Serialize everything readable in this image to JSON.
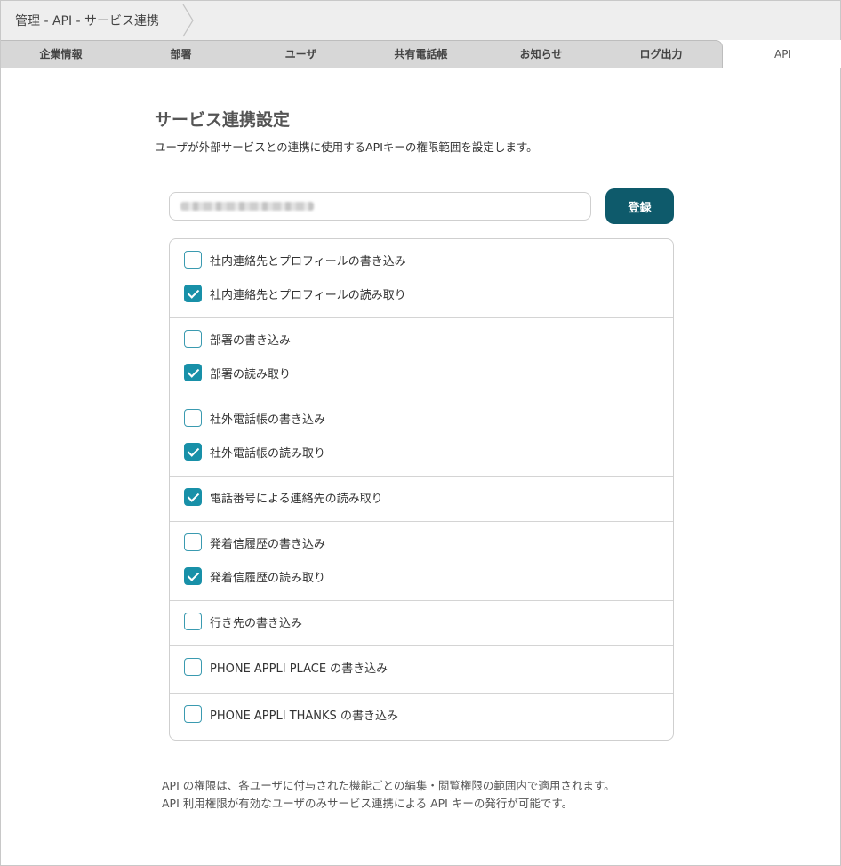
{
  "breadcrumb": "管理 - API - サービス連携",
  "tabs": [
    {
      "label": "企業情報",
      "active": false
    },
    {
      "label": "部署",
      "active": false
    },
    {
      "label": "ユーザ",
      "active": false
    },
    {
      "label": "共有電話帳",
      "active": false
    },
    {
      "label": "お知らせ",
      "active": false
    },
    {
      "label": "ログ出力",
      "active": false
    },
    {
      "label": "API",
      "active": true
    }
  ],
  "main": {
    "title": "サービス連携設定",
    "description": "ユーザが外部サービスとの連携に使用するAPIキーの権限範囲を設定します。",
    "register_label": "登録"
  },
  "permissions": [
    {
      "label": "社内連絡先とプロフィールの書き込み",
      "checked": false
    },
    {
      "label": "社内連絡先とプロフィールの読み取り",
      "checked": true
    },
    {
      "label": "部署の書き込み",
      "checked": false
    },
    {
      "label": "部署の読み取り",
      "checked": true
    },
    {
      "label": "社外電話帳の書き込み",
      "checked": false
    },
    {
      "label": "社外電話帳の読み取り",
      "checked": true
    },
    {
      "label": "電話番号による連絡先の読み取り",
      "checked": true
    },
    {
      "label": "発着信履歴の書き込み",
      "checked": false
    },
    {
      "label": "発着信履歴の読み取り",
      "checked": true
    },
    {
      "label": "行き先の書き込み",
      "checked": false
    },
    {
      "label": "PHONE APPLI PLACE の書き込み",
      "checked": false
    },
    {
      "label": "PHONE APPLI THANKS の書き込み",
      "checked": false
    }
  ],
  "notes": [
    "API の権限は、各ユーザに付与された機能ごとの編集・閲覧権限の範囲内で適用されます。",
    "API 利用権限が有効なユーザのみサービス連携による API キーの発行が可能です。"
  ],
  "colors": {
    "accent": "#1890a8",
    "button": "#0e5a6b",
    "tab_bar": "#d7d7d7"
  }
}
